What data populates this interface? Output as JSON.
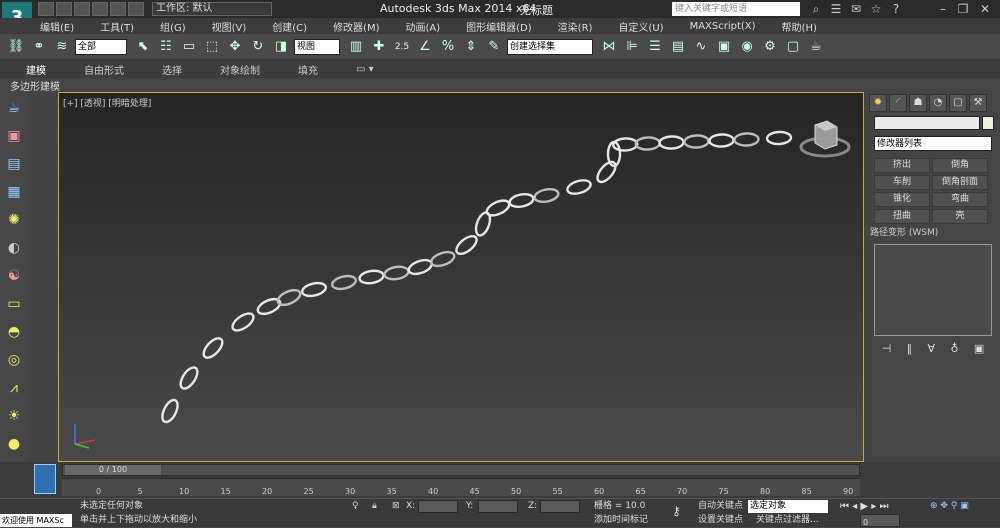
{
  "app": {
    "title": "Autodesk 3ds Max  2014 x64",
    "document": "无标题",
    "workspace_label": "工作区: 默认",
    "search_placeholder": "键入关键字或短语"
  },
  "menu": [
    "编辑(E)",
    "工具(T)",
    "组(G)",
    "视图(V)",
    "创建(C)",
    "修改器(M)",
    "动画(A)",
    "图形编辑器(D)",
    "渲染(R)",
    "自定义(U)",
    "MAXScript(X)",
    "帮助(H)"
  ],
  "toolbar": {
    "filter_select": "全部",
    "coord_select": "视图",
    "named_selection": "创建选择集",
    "snap_label": "2.5"
  },
  "ribbon": {
    "tabs": [
      "建模",
      "自由形式",
      "选择",
      "对象绘制",
      "填充"
    ],
    "subtitle": "多边形建模"
  },
  "viewport": {
    "label": "[+] [透视] [明暗处理]"
  },
  "command_panel": {
    "modifier_list": "修改器列表",
    "buttons": [
      "挤出",
      "倒角",
      "车削",
      "倒角剖面",
      "锥化",
      "弯曲",
      "扭曲",
      "壳"
    ],
    "stack_label": "路径变形 (WSM)"
  },
  "timeline": {
    "slider_label": "0 / 100",
    "ticks": [
      "0",
      "5",
      "10",
      "15",
      "20",
      "25",
      "30",
      "35",
      "40",
      "45",
      "50",
      "55",
      "60",
      "65",
      "70",
      "75",
      "80",
      "85",
      "90"
    ]
  },
  "status": {
    "selection": "未选定任何对象",
    "prompt": "单击并上下拖动以放大和缩小",
    "x_label": "X:",
    "y_label": "Y:",
    "z_label": "Z:",
    "grid": "栅格 = 10.0",
    "auto_key": "自动关键点",
    "set_key": "设置关键点",
    "key_select": "选定对象",
    "add_time_tag": "添加时间标记",
    "key_filters": "关键点过滤器...",
    "welcome": "欢迎使用 MAXSc",
    "frame_value": "0"
  }
}
